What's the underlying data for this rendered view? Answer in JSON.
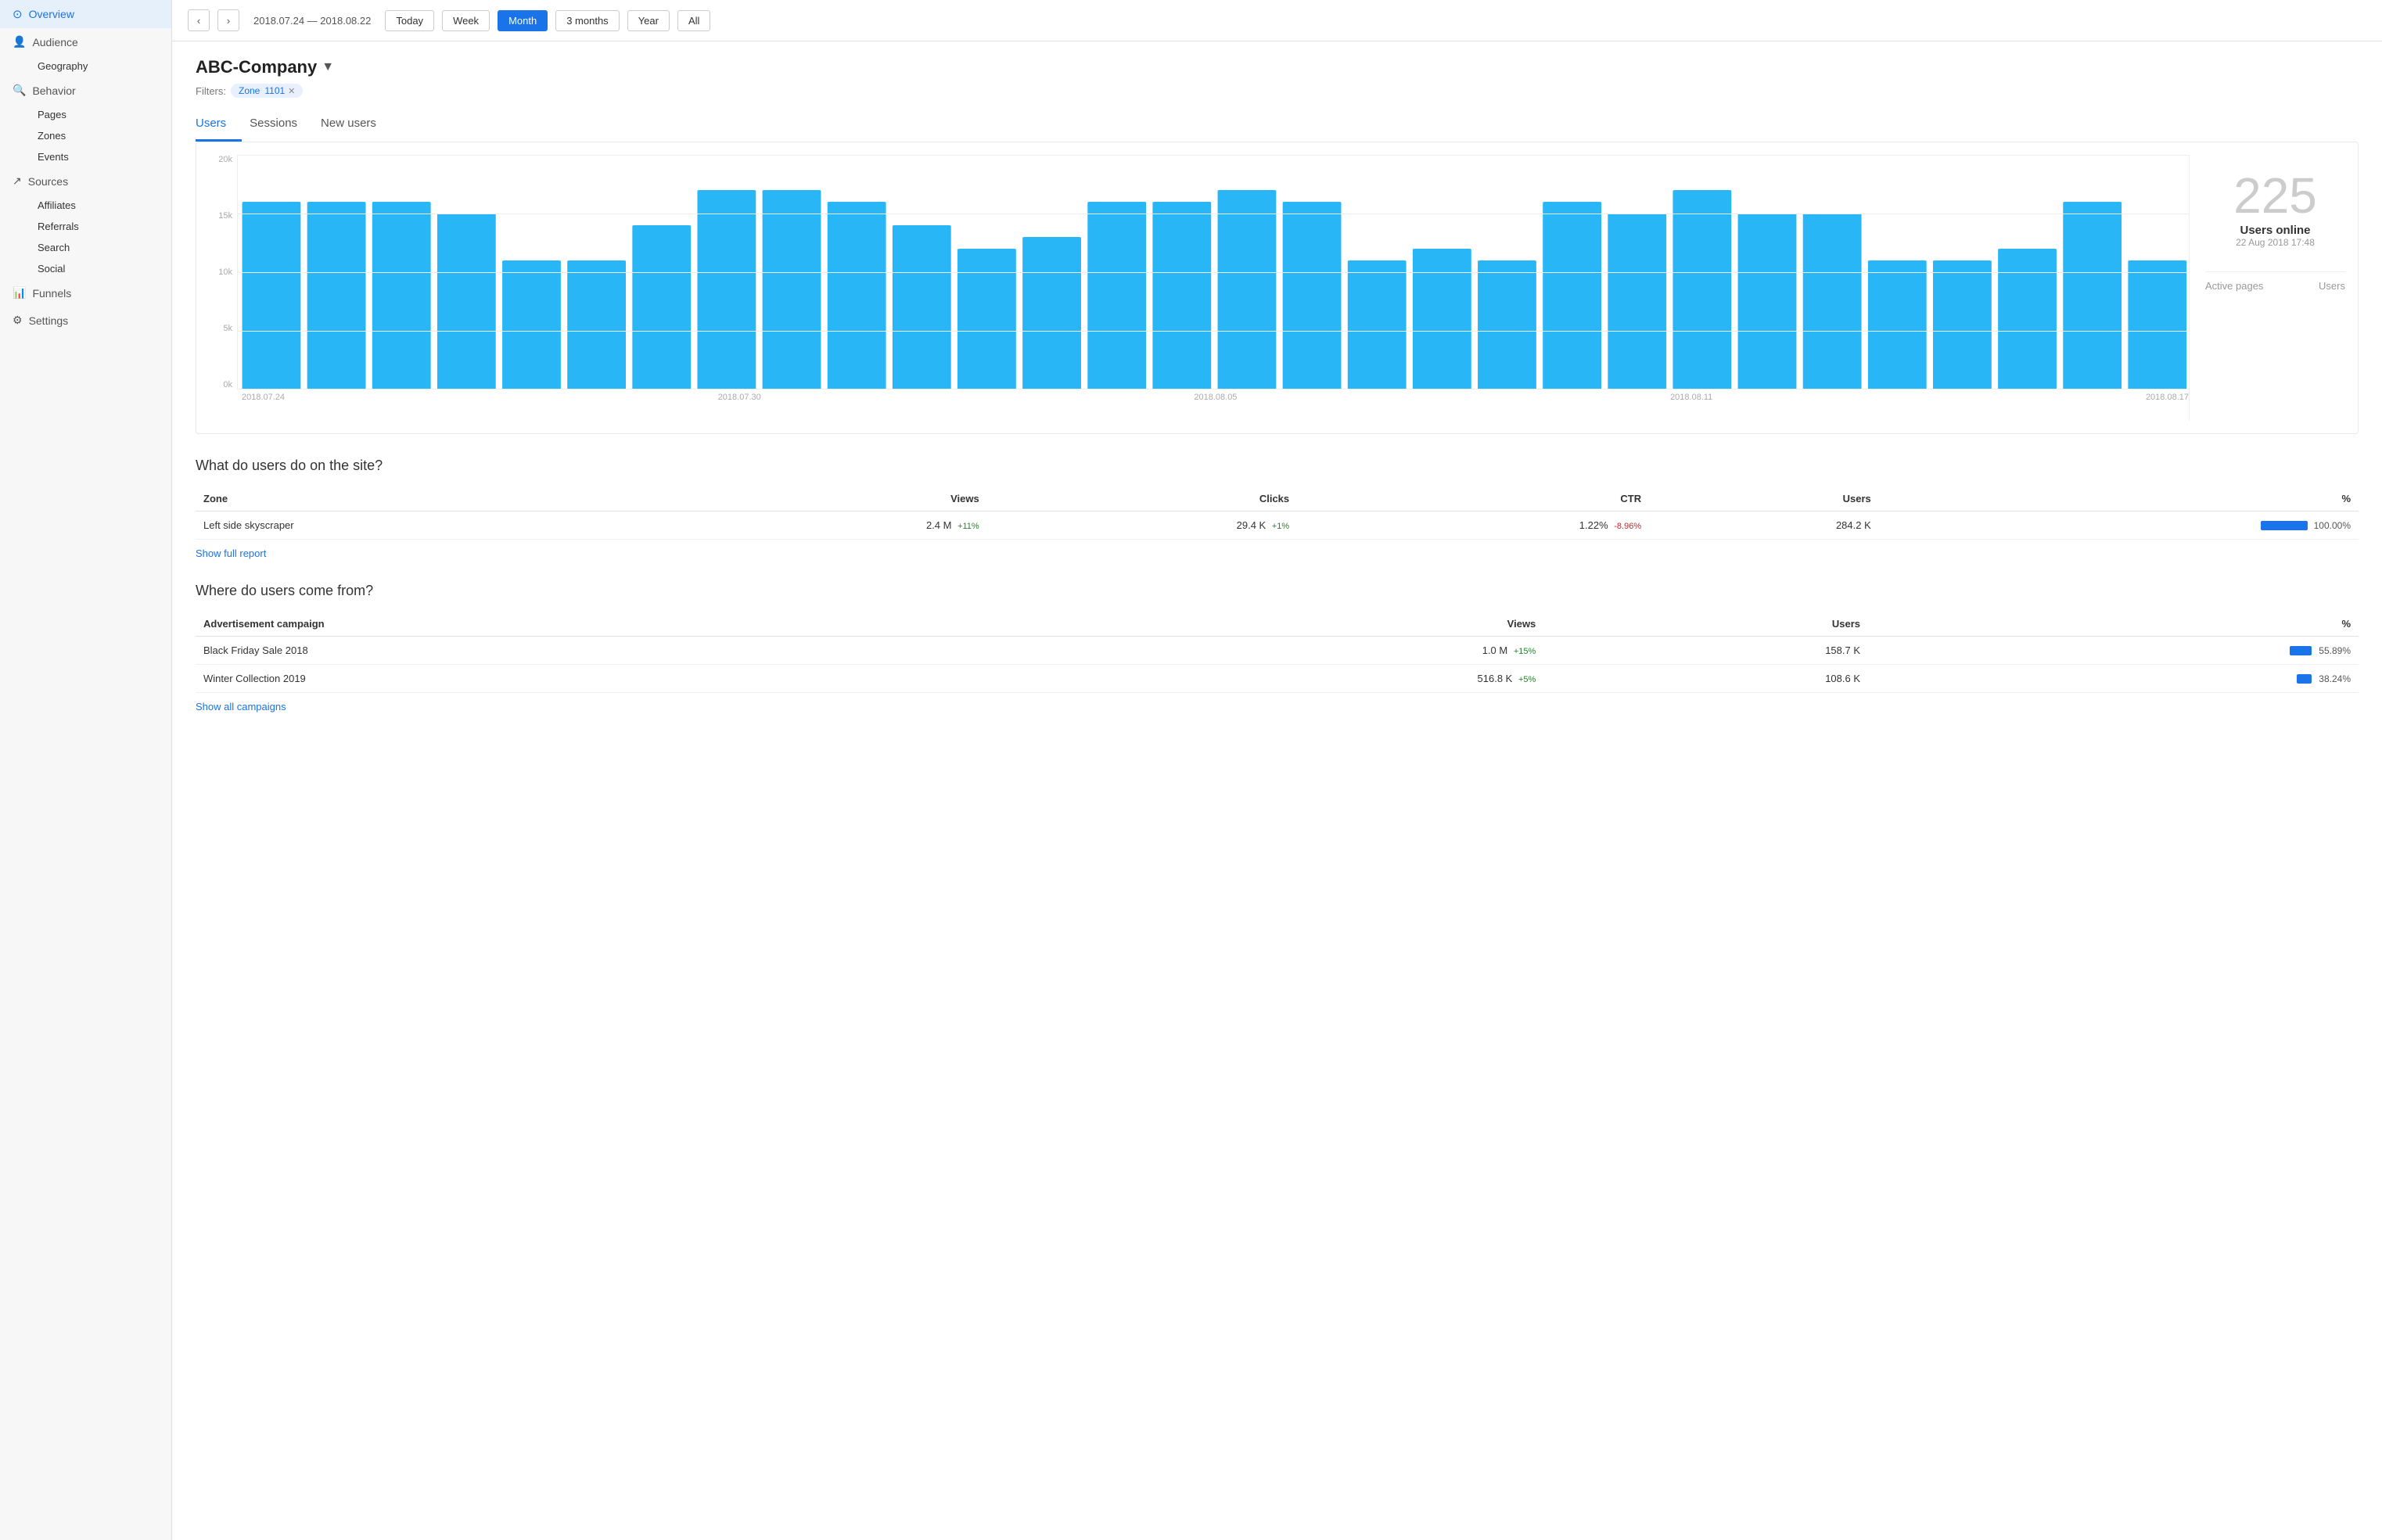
{
  "sidebar": {
    "overview": "Overview",
    "audience": "Audience",
    "geography": "Geography",
    "behavior": "Behavior",
    "pages": "Pages",
    "zones": "Zones",
    "events": "Events",
    "sources": "Sources",
    "affiliates": "Affiliates",
    "referrals": "Referrals",
    "search": "Search",
    "social": "Social",
    "funnels": "Funnels",
    "settings": "Settings"
  },
  "topbar": {
    "dateRange": "2018.07.24 — 2018.08.22",
    "buttons": [
      "Today",
      "Week",
      "Month",
      "3 months",
      "Year",
      "All"
    ],
    "activeBtn": "Month"
  },
  "header": {
    "companyName": "ABC-Company",
    "filterLabel": "Filters:",
    "filterZone": "Zone",
    "filterValue": "1101"
  },
  "tabs": [
    "Users",
    "Sessions",
    "New users"
  ],
  "chart": {
    "activeTab": "Users",
    "yLabels": [
      "20k",
      "15k",
      "10k",
      "5k",
      "0k"
    ],
    "xLabels": [
      "2018.07.24",
      "2018.07.30",
      "2018.08.05",
      "2018.08.11",
      "2018.08.17"
    ],
    "bars": [
      16,
      16,
      16,
      15,
      11,
      11,
      14,
      17,
      17,
      16,
      14,
      12,
      13,
      16,
      16,
      17,
      16,
      11,
      12,
      11,
      16,
      15,
      17,
      15,
      15,
      11,
      11,
      12,
      16,
      11
    ],
    "usersOnline": "225",
    "usersOnlineLabel": "Users online",
    "usersOnlineTime": "22 Aug 2018 17:48",
    "activePagesLabel": "Active pages",
    "activePagesUsers": "Users"
  },
  "zonesSection": {
    "title": "What do users do on the site?",
    "columns": [
      "Zone",
      "Views",
      "Clicks",
      "CTR",
      "Users",
      "%"
    ],
    "rows": [
      {
        "zone": "Left side skyscraper",
        "views": "2.4 M",
        "viewsDelta": "+11%",
        "viewsDeltaPos": true,
        "clicks": "29.4 K",
        "clicksDelta": "+1%",
        "clicksDeltaPos": true,
        "ctr": "1.22%",
        "ctrDelta": "-8.96%",
        "ctrDeltaPos": false,
        "users": "284.2 K",
        "barWidth": 100,
        "pct": "100.00%"
      }
    ],
    "showLink": "Show full report"
  },
  "campaignsSection": {
    "title": "Where do users come from?",
    "columns": [
      "Advertisement campaign",
      "Views",
      "Users",
      "%"
    ],
    "rows": [
      {
        "campaign": "Black Friday Sale 2018",
        "views": "1.0 M",
        "viewsDelta": "+15%",
        "viewsDeltaPos": true,
        "users": "158.7 K",
        "barWidth": 56,
        "pct": "55.89%"
      },
      {
        "campaign": "Winter Collection 2019",
        "views": "516.8 K",
        "viewsDelta": "+5%",
        "viewsDeltaPos": true,
        "users": "108.6 K",
        "barWidth": 38,
        "pct": "38.24%"
      }
    ],
    "showLink": "Show all campaigns"
  }
}
